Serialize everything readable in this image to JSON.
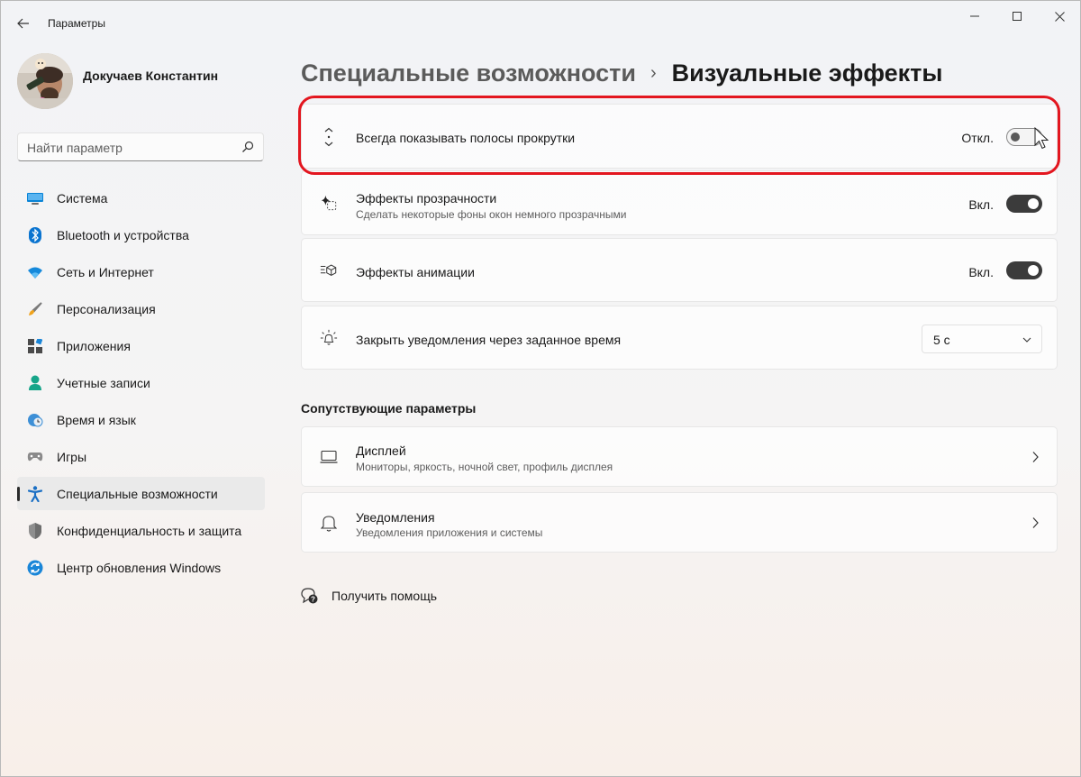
{
  "window": {
    "title": "Параметры"
  },
  "user": {
    "name": "Докучаев Константин"
  },
  "search": {
    "placeholder": "Найти параметр"
  },
  "sidebar": {
    "items": [
      {
        "label": "Система",
        "icon": "system-icon"
      },
      {
        "label": "Bluetooth и устройства",
        "icon": "bluetooth-icon"
      },
      {
        "label": "Сеть и Интернет",
        "icon": "wifi-icon"
      },
      {
        "label": "Персонализация",
        "icon": "brush-icon"
      },
      {
        "label": "Приложения",
        "icon": "apps-icon"
      },
      {
        "label": "Учетные записи",
        "icon": "person-icon"
      },
      {
        "label": "Время и язык",
        "icon": "clock-globe-icon"
      },
      {
        "label": "Игры",
        "icon": "gamepad-icon"
      },
      {
        "label": "Специальные возможности",
        "icon": "accessibility-icon",
        "active": true
      },
      {
        "label": "Конфиденциальность и защита",
        "icon": "shield-icon"
      },
      {
        "label": "Центр обновления Windows",
        "icon": "update-icon"
      }
    ]
  },
  "breadcrumb": {
    "parent": "Специальные возможности",
    "separator": "›",
    "current": "Визуальные эффекты"
  },
  "settings": {
    "scrollbars": {
      "title": "Всегда показывать полосы прокрутки",
      "state_label": "Откл.",
      "on": false
    },
    "transparency": {
      "title": "Эффекты прозрачности",
      "subtitle": "Сделать некоторые фоны окон немного прозрачными",
      "state_label": "Вкл.",
      "on": true
    },
    "animation": {
      "title": "Эффекты анимации",
      "state_label": "Вкл.",
      "on": true
    },
    "notifications_timeout": {
      "title": "Закрыть уведомления через заданное время",
      "value": "5 с"
    }
  },
  "related": {
    "title": "Сопутствующие параметры",
    "items": [
      {
        "title": "Дисплей",
        "subtitle": "Мониторы, яркость, ночной свет, профиль дисплея"
      },
      {
        "title": "Уведомления",
        "subtitle": "Уведомления приложения и системы"
      }
    ]
  },
  "help": {
    "label": "Получить помощь"
  },
  "colors": {
    "highlight": "#e3161f",
    "toggle_on": "#3b3b3b",
    "accent_blue": "#0067c0"
  }
}
